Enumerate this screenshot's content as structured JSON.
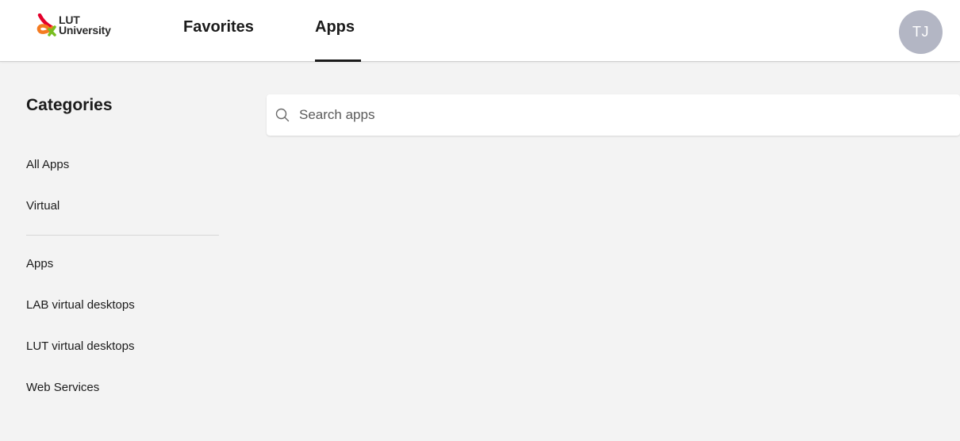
{
  "brand": {
    "logo_line1": "LUT",
    "logo_line2": "University",
    "colors": {
      "logo_orange": "#f47b20",
      "logo_red": "#e4002b",
      "logo_green": "#78be20"
    }
  },
  "header": {
    "tabs": [
      {
        "label": "Favorites",
        "active": false
      },
      {
        "label": "Apps",
        "active": true
      }
    ],
    "avatar_initials": "TJ",
    "avatar_color": "#b3b6c4"
  },
  "sidebar": {
    "title": "Categories",
    "group1": [
      {
        "label": "All Apps"
      },
      {
        "label": "Virtual"
      }
    ],
    "group2": [
      {
        "label": "Apps"
      },
      {
        "label": "LAB virtual desktops"
      },
      {
        "label": "LUT virtual desktops"
      },
      {
        "label": "Web Services"
      }
    ]
  },
  "search": {
    "placeholder": "Search apps",
    "value": "",
    "icon": "search-icon"
  }
}
